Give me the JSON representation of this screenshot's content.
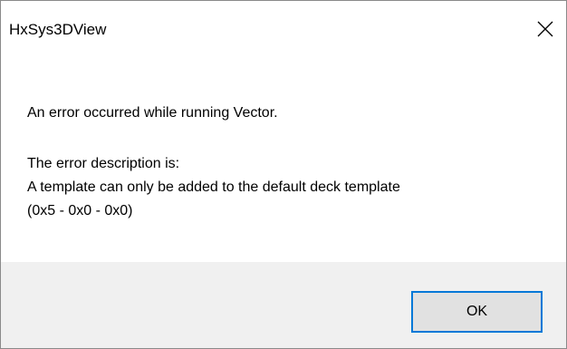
{
  "window": {
    "title": "HxSys3DView",
    "close_icon": "close-icon"
  },
  "message": {
    "line1": "An error occurred while running Vector.",
    "line2": "The error description is:",
    "line3": "A template can only be added to the default deck template",
    "line4": "(0x5 - 0x0 - 0x0)"
  },
  "buttons": {
    "ok_label": "OK"
  },
  "colors": {
    "focus_border": "#0078d7",
    "footer_bg": "#f0f0f0",
    "button_bg": "#e1e1e1"
  }
}
